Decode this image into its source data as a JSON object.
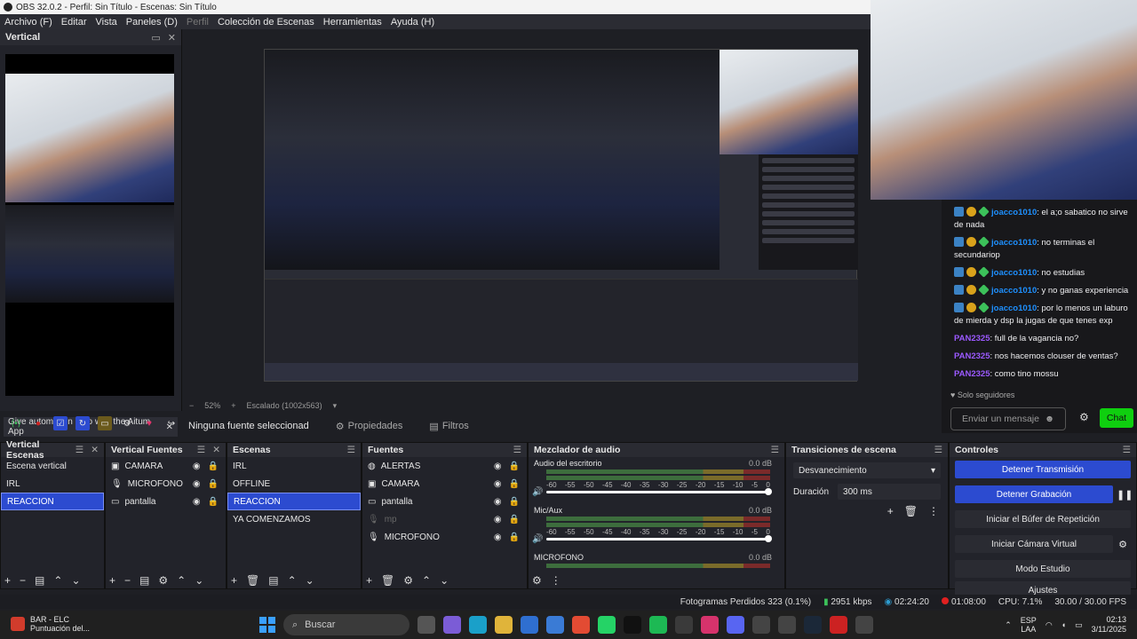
{
  "window": {
    "title": "OBS 32.0.2 - Perfil: Sin Título - Escenas: Sin Título"
  },
  "menu": [
    {
      "label": "Archivo (F)",
      "dim": false
    },
    {
      "label": "Editar",
      "dim": false
    },
    {
      "label": "Vista",
      "dim": false
    },
    {
      "label": "Paneles (D)",
      "dim": false
    },
    {
      "label": "Perfil",
      "dim": true
    },
    {
      "label": "Colección de Escenas",
      "dim": false
    },
    {
      "label": "Herramientas",
      "dim": false
    },
    {
      "label": "Ayuda (H)",
      "dim": false
    }
  ],
  "vertical_dock": {
    "title": "Vertical",
    "hint": "Give automation a go with the Aitum App"
  },
  "preview_status": {
    "zoom": "52%",
    "scale": "Escalado (1002x563)"
  },
  "source_toolbar": {
    "no_source": "Ninguna fuente seleccionad",
    "properties": "Propiedades",
    "filters": "Filtros"
  },
  "chat": {
    "messages": [
      {
        "user": "joacco1010",
        "text": ": el a;o sabatico no sirve de nada",
        "badges": true,
        "color": "blue"
      },
      {
        "user": "joacco1010",
        "text": ": no terminas el secundariop",
        "badges": true,
        "color": "blue"
      },
      {
        "user": "joacco1010",
        "text": ": no estudias",
        "badges": true,
        "color": "blue"
      },
      {
        "user": "joacco1010",
        "text": ": y no ganas experiencia",
        "badges": true,
        "color": "blue"
      },
      {
        "user": "joacco1010",
        "text": ": por lo menos un laburo de mierda y dsp la jugas de que tenes exp",
        "badges": true,
        "color": "blue"
      },
      {
        "user": "PAN2325",
        "text": ": full de la vagancia no?",
        "badges": false,
        "color": "purple"
      },
      {
        "user": "PAN2325",
        "text": ": nos hacemos clouser de ventas?",
        "badges": false,
        "color": "purple"
      },
      {
        "user": "PAN2325",
        "text": ": como tino mossu",
        "badges": false,
        "color": "purple"
      }
    ],
    "followers_only": "Solo seguidores",
    "input_placeholder": "Enviar un mensaje",
    "send_label": "Chat"
  },
  "docks": {
    "vertical_scenes": {
      "title": "Vertical Escenas",
      "items": [
        "Escena vertical",
        "IRL",
        "REACCION"
      ],
      "selected": 2
    },
    "vertical_sources": {
      "title": "Vertical Fuentes",
      "items": [
        {
          "label": "CAMARA",
          "icon": "camera-icon"
        },
        {
          "label": "MICROFONO",
          "icon": "microphone-icon"
        },
        {
          "label": "pantalla",
          "icon": "monitor-icon"
        }
      ]
    },
    "scenes": {
      "title": "Escenas",
      "items": [
        "IRL",
        "OFFLINE",
        "REACCION",
        "YA COMENZAMOS"
      ],
      "selected": 2
    },
    "sources": {
      "title": "Fuentes",
      "items": [
        {
          "label": "ALERTAS",
          "icon": "globe-icon",
          "dim": false
        },
        {
          "label": "CAMARA",
          "icon": "camera-icon",
          "dim": false
        },
        {
          "label": "pantalla",
          "icon": "monitor-icon",
          "dim": false
        },
        {
          "label": "mp",
          "icon": "microphone-icon",
          "dim": true
        },
        {
          "label": "MICROFONO",
          "icon": "microphone-icon",
          "dim": false
        }
      ]
    },
    "mixer": {
      "title": "Mezclador de audio",
      "channels": [
        {
          "name": "Audio del escritorio",
          "db": "0.0 dB"
        },
        {
          "name": "Mic/Aux",
          "db": "0.0 dB"
        },
        {
          "name": "MICROFONO",
          "db": "0.0 dB"
        }
      ],
      "ticks": [
        "-60",
        "-55",
        "-50",
        "-45",
        "-40",
        "-35",
        "-30",
        "-25",
        "-20",
        "-15",
        "-10",
        "-5",
        "0"
      ]
    },
    "transitions": {
      "title": "Transiciones de escena",
      "selected": "Desvanecimiento",
      "duration_label": "Duración",
      "duration_value": "300 ms"
    },
    "controls": {
      "title": "Controles",
      "buttons": [
        {
          "label": "Detener Transmisión",
          "active": true
        },
        {
          "label": "Detener Grabación",
          "active": true
        },
        {
          "label": "Iniciar el Búfer de Repetición",
          "active": false
        },
        {
          "label": "Iniciar Cámara Virtual",
          "active": false
        },
        {
          "label": "Modo Estudio",
          "active": false
        },
        {
          "label": "Ajustes",
          "active": false
        }
      ]
    }
  },
  "status": {
    "dropped": "Fotogramas Perdidos 323 (0.1%)",
    "bitrate": "2951 kbps",
    "stream_time": "02:24:20",
    "rec_time": "01:08:00",
    "cpu": "CPU: 7.1%",
    "fps": "30.00 / 30.00 FPS"
  },
  "taskbar": {
    "app_title": "BAR - ELC",
    "app_sub": "Puntuación del...",
    "search": "Buscar",
    "lang": "ESP",
    "lang_sub": "LAA",
    "time": "02:13",
    "date": "3/11/2025"
  },
  "colors": {
    "accent": "#2c4bd0",
    "chat_green": "#0fcf0f",
    "rec_red": "#e02020"
  }
}
